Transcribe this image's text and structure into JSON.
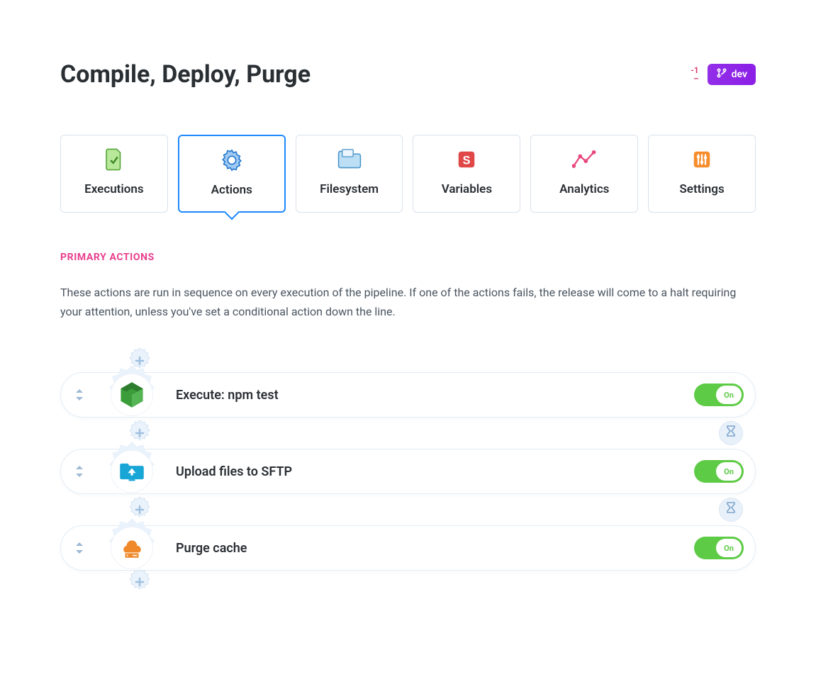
{
  "header": {
    "title": "Compile, Deploy, Purge",
    "runs_count": "-1",
    "runs_dash": "–",
    "branch_label": "dev"
  },
  "tabs": [
    {
      "id": "executions",
      "label": "Executions",
      "icon": "check-file-icon",
      "color": "#7fd15a"
    },
    {
      "id": "actions",
      "label": "Actions",
      "icon": "gear-icon",
      "color": "#2a8be6",
      "active": true
    },
    {
      "id": "filesystem",
      "label": "Filesystem",
      "icon": "folder-icon",
      "color": "#6bb5e8"
    },
    {
      "id": "variables",
      "label": "Variables",
      "icon": "dollar-box-icon",
      "color": "#e04848"
    },
    {
      "id": "analytics",
      "label": "Analytics",
      "icon": "chart-icon",
      "color": "#e8467e"
    },
    {
      "id": "settings",
      "label": "Settings",
      "icon": "sliders-icon",
      "color": "#f78c2b"
    }
  ],
  "section": {
    "title": "Primary Actions",
    "description": "These actions are run in sequence on every execution of the pipeline. If one of the actions fails, the release will come to a halt requiring your attention, unless you've set a conditional action down the line."
  },
  "actions": [
    {
      "id": "npm-test",
      "label": "Execute: npm test",
      "icon": "node-icon",
      "icon_color": "#3a9d3a",
      "toggle": "On",
      "enabled": true
    },
    {
      "id": "sftp",
      "label": "Upload files to SFTP",
      "icon": "upload-folder-icon",
      "icon_color": "#17a6d6",
      "toggle": "On",
      "enabled": true,
      "sleep_after": true
    },
    {
      "id": "purge",
      "label": "Purge cache",
      "icon": "cloud-server-icon",
      "icon_color": "#f0892a",
      "toggle": "On",
      "enabled": true,
      "sleep_after": true
    }
  ]
}
